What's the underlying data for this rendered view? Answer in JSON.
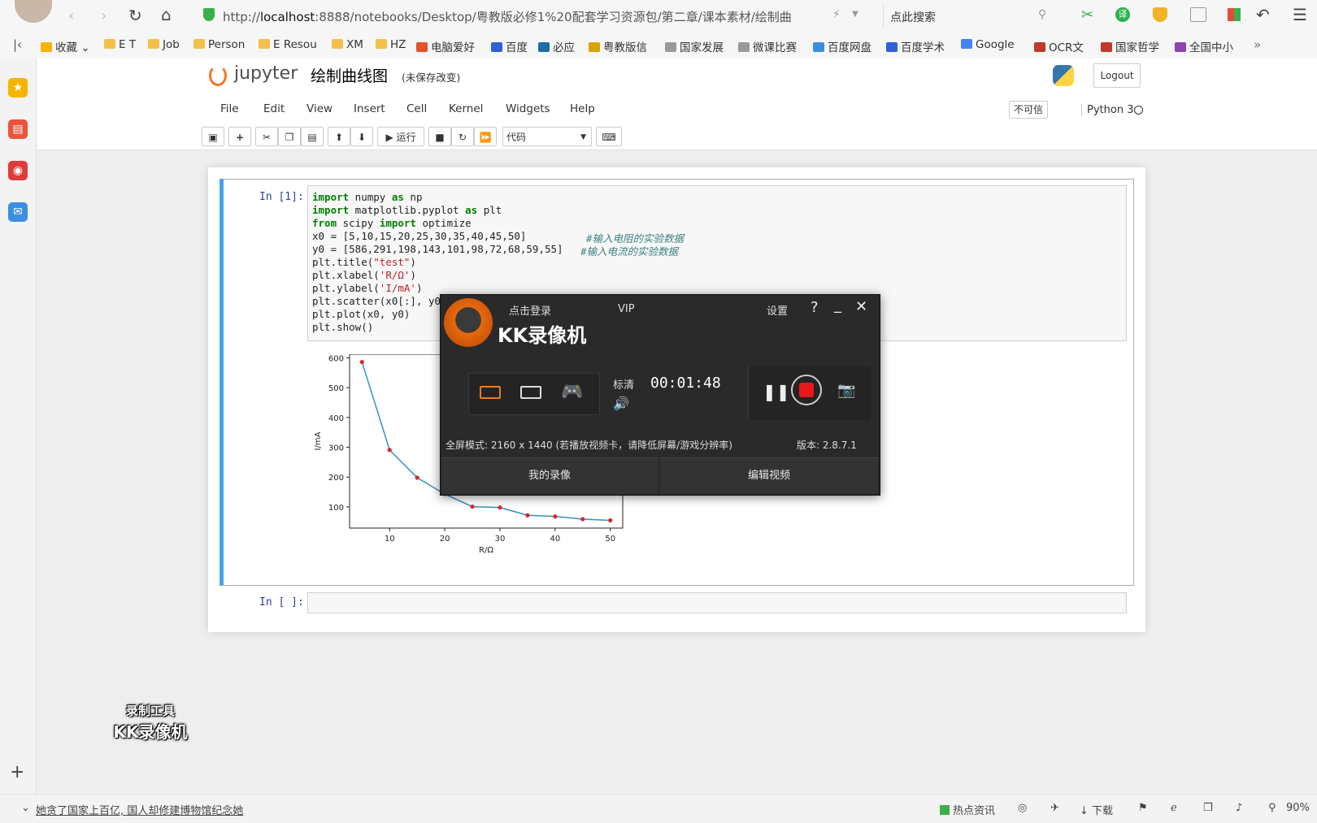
{
  "browser": {
    "url_prefix": "http://",
    "url_host": "localhost",
    "url_rest": ":8888/notebooks/Desktop/粤教版必修1%20配套学习资源包/第二章/课本素材/绘制曲",
    "search_placeholder": "点此搜索",
    "zoom": "90%"
  },
  "bookmarks": [
    {
      "label": "收藏",
      "color": "#f5b400"
    },
    {
      "label": "E T",
      "color": "#f3c04a"
    },
    {
      "label": "Job",
      "color": "#f3c04a"
    },
    {
      "label": "Person",
      "color": "#f3c04a"
    },
    {
      "label": "E Resou",
      "color": "#f3c04a"
    },
    {
      "label": "XM",
      "color": "#f3c04a"
    },
    {
      "label": "HZ",
      "color": "#f3c04a"
    },
    {
      "label": "电脑爱好",
      "color": "#e5522b"
    },
    {
      "label": "百度",
      "color": "#3060d8"
    },
    {
      "label": "必应",
      "color": "#1a6fa8"
    },
    {
      "label": "粤教版信",
      "color": "#d9a400"
    },
    {
      "label": "国家发展",
      "color": "#999999"
    },
    {
      "label": "微课比赛",
      "color": "#999999"
    },
    {
      "label": "百度网盘",
      "color": "#3b8fe0"
    },
    {
      "label": "百度学术",
      "color": "#3060d8"
    },
    {
      "label": "Google",
      "color": "#4285f4"
    },
    {
      "label": "OCR文",
      "color": "#c0392b"
    },
    {
      "label": "国家哲学",
      "color": "#c0392b"
    },
    {
      "label": "全国中小",
      "color": "#8e44ad"
    }
  ],
  "jupyter": {
    "logo_text": "jupyter",
    "notebook_title": "绘制曲线图",
    "save_status": "(未保存改变)",
    "logout": "Logout",
    "menus": [
      "File",
      "Edit",
      "View",
      "Insert",
      "Cell",
      "Kernel",
      "Widgets",
      "Help"
    ],
    "trust": "不可信",
    "kernel": "Python 3",
    "run_label": "运行",
    "cell_type": "代码"
  },
  "cell1": {
    "prompt": "In [1]:",
    "code": {
      "l1_kw": "import",
      "l1_a": " numpy ",
      "l1_kw2": "as",
      "l1_b": " np",
      "l2_kw": "import",
      "l2_a": " matplotlib.pyplot ",
      "l2_kw2": "as",
      "l2_b": " plt",
      "l3_kw": "from",
      "l3_a": " scipy ",
      "l3_kw2": "import",
      "l3_b": " optimize",
      "l4": "x0 = [5,10,15,20,25,30,35,40,45,50]",
      "l4_cm": "#输入电阻的实验数据",
      "l5": "y0 = [586,291,198,143,101,98,72,68,59,55]",
      "l5_cm": "#输入电流的实验数据",
      "l6_a": "plt.title(",
      "l6_s": "\"test\"",
      "l6_b": ")",
      "l7_a": "plt.xlabel(",
      "l7_s": "'R/Ω'",
      "l7_b": ")",
      "l8_a": "plt.ylabel(",
      "l8_s": "'I/mA'",
      "l8_b": ")",
      "l9": "plt.scatter(x0[:], y0",
      "l10": "plt.plot(x0, y0)",
      "l11": "plt.show()"
    }
  },
  "cell2": {
    "prompt": "In [ ]:"
  },
  "chart_data": {
    "type": "line",
    "x": [
      5,
      10,
      15,
      20,
      25,
      30,
      35,
      40,
      45,
      50
    ],
    "series": [
      {
        "values": [
          586,
          291,
          198,
          143,
          101,
          98,
          72,
          68,
          59,
          55
        ],
        "line_color": "#3a8fc1",
        "marker_color": "#d62728"
      }
    ],
    "xlabel": "R/Ω",
    "ylabel": "I/mA",
    "xticks": [
      10,
      20,
      30,
      40,
      50
    ],
    "yticks": [
      100,
      200,
      300,
      400,
      500,
      600
    ],
    "xlim": [
      2.75,
      52.25
    ],
    "ylim": [
      29,
      612
    ],
    "grid": false
  },
  "kk": {
    "login": "点击登录",
    "vip": "VIP",
    "settings": "设置",
    "help": "?",
    "title": "KK录像机",
    "quality": "标清",
    "timer": "00:01:48",
    "info": "全屏模式: 2160 x 1440 (若播放视频卡，请降低屏幕/游戏分辨率)",
    "version": "版本: 2.8.7.1",
    "my_videos": "我的录像",
    "edit_video": "编辑视频"
  },
  "watermark": {
    "line1": "录制工具",
    "line2": "KK录像机"
  },
  "status_bar": {
    "news": "她贪了国家上百亿, 国人却修建博物馆纪念她",
    "hot": "热点资讯",
    "download": "下载"
  }
}
